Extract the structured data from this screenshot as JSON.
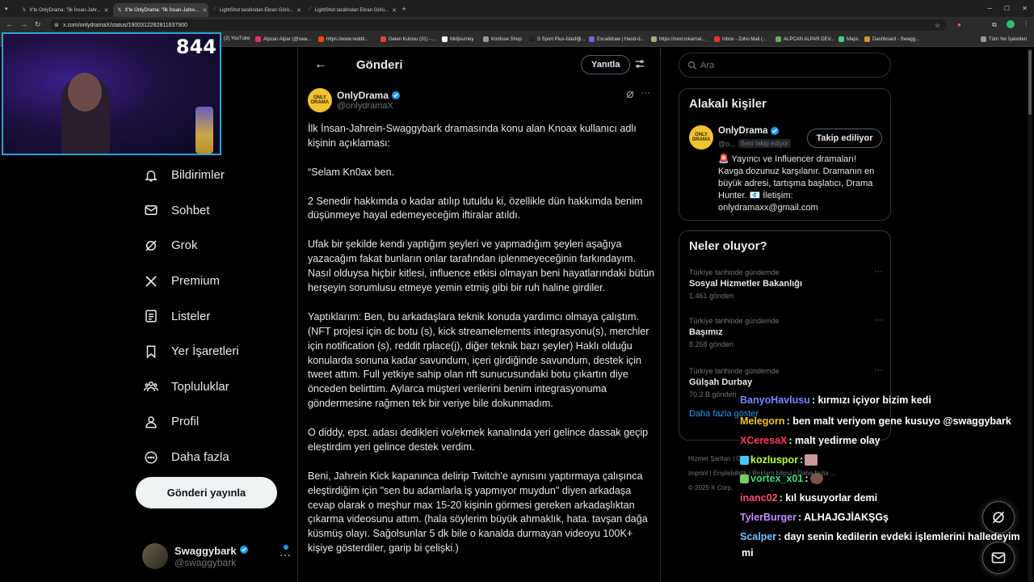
{
  "browser": {
    "tabs": [
      {
        "label": "X'te OnlyDrama: \"İlk İnsan-Jahr...",
        "active": false
      },
      {
        "label": "X'te OnlyDrama: \"İlk İnsan-Jahre...",
        "active": true
      },
      {
        "label": "LightShot tarafından Ekran Görü...",
        "active": false
      },
      {
        "label": "LightShot tarafından Ekran Görü...",
        "active": false
      }
    ],
    "url": "x.com/onlydramaX/status/1900312282811637900",
    "bookmarks": [
      "(2) YouTube",
      "Alpcan Alpar (@swa...",
      "https://www.reddit...",
      "Gelen Kutusu (31) -...",
      "Midjourney",
      "Konfuse Shop",
      "S Sport Plus-İstediği...",
      "Excalidraw | Hand-d...",
      "https://next.inkarnat...",
      "Inbox - Zoho Mail (...",
      "ALPCAN ALPAR DEV...",
      "Maps",
      "Dashboard - Swagg..."
    ],
    "bookmarks_all": "Tüm Yer İşaretleri"
  },
  "stream": {
    "viewer_count": "844"
  },
  "nav": {
    "items": [
      "Bildirimler",
      "Sohbet",
      "Grok",
      "Premium",
      "Listeler",
      "Yer İşaretleri",
      "Topluluklar",
      "Profil",
      "Daha fazla"
    ],
    "post_button": "Gönderi yayınla",
    "account": {
      "name": "Swaggybark",
      "handle": "@swaggybark"
    }
  },
  "header": {
    "title": "Gönderi",
    "reply_label": "Yanıtla"
  },
  "post": {
    "author_name": "OnlyDrama",
    "author_handle": "@onlydramaX",
    "avatar_text": "ONLY DRAMA",
    "text": "İlk İnsan-Jahrein-Swaggybark dramasında konu alan Knoax kullanıcı adlı kişinin açıklaması:\n\n“Selam Kn0ax ben.\n\n2 Senedir hakkımda o kadar atılıp tutuldu ki, özellikle dün hakkımda benim düşünmeye hayal edemeyeceğim iftiralar atıldı.\n\nUfak bir şekilde kendi yaptığım şeyleri ve yapmadığım şeyleri aşağıya yazacağım fakat bunların onlar tarafından iplenmeyeceğinin farkındayım. Nasıl olduysa hiçbir kitlesi, influence etkisi olmayan beni hayatlarındaki bütün herşeyin sorumlusu etmeye yemin etmiş gibi bir ruh haline girdiler.\n\nYaptıklarım: Ben, bu arkadaşlara teknik konuda yardımcı olmaya çalıştım. (NFT projesi için dc botu (s), kick streamelements integrasyonu(s), merchler için notification (s), reddit rplace(j), diğer teknik bazı şeyler) Haklı olduğu konularda sonuna kadar savundum, içeri girdiğinde savundum, destek için tweet attım. Full yetkiye sahip olan nft sunucusundaki botu çıkartın diye önceden belirttim. Aylarca müşteri verilerini benim integrasyonuma göndermesine rağmen tek bir veriye bile dokunmadım.\n\nO diddy, epst. adası dedikleri vo/ekmek kanalında yeri gelince dassak geçip eleştirdim yeri gelince destek verdim.\n\nBeni, Jahrein Kick kapanınca delirip Twitch'e aynısını yaptırmaya çalışınca eleştirdiğim için \"sen bu adamlarla iş yapmıyor muydun\" diyen arkadaşa cevap olarak o meşhur max 15-20 kişinin görmesi gereken arkadaşlıktan çıkarma videosunu attım. (hala söylerim büyük ahmaklık, hata. tavşan dağa küsmüş olayı. Sağolsunlar 5 dk bile o kanalda durmayan videoyu 100K+ kişiye gösterdiler, garip bi çelişki.)"
  },
  "sidebar": {
    "search_placeholder": "Ara",
    "related": {
      "title": "Alakalı kişiler",
      "name": "OnlyDrama",
      "handle": "@o...",
      "follows_you": "Seni takip ediyor",
      "follow_label": "Takip ediliyor",
      "bio": "🚨 Yayıncı ve Influencer dramaları! Kavga dozunuz karşılanır. Dramanın en büyük adresi, tartışma başlatıcı, Drama Hunter. 📧 İletişim: onlydramaxx@gmail.com"
    },
    "trends": {
      "title": "Neler oluyor?",
      "items": [
        {
          "context": "Türkiye tarihinde gündemde",
          "title": "Sosyal Hizmetler Bakanlığı",
          "count": "1.461 gönderi"
        },
        {
          "context": "Türkiye tarihinde gündemde",
          "title": "Başımız",
          "count": "8.268 gönderi"
        },
        {
          "context": "Türkiye tarihinde gündemde",
          "title": "Gülşah Durbay",
          "count": "70,2 B gönderi"
        }
      ],
      "show_more": "Daha fazla göster"
    },
    "footer": {
      "line1": "Hizmet Şartları  |  Gizlilik Politikası  |",
      "line2": "Imprint  |  Erişilebilirlik  |  Reklam bilgisi  |  Daha fazla ...",
      "line3": "© 2025 X Corp."
    }
  },
  "chat": [
    {
      "user": "BanyoHavlusu",
      "color": "#6f8cff",
      "msg": ": kırmızı içiyor bizim kedi"
    },
    {
      "user": "Melegorn",
      "color": "#f0c419",
      "msg": ": ben malt veriyom gene kusuyo @swaggybark"
    },
    {
      "user": "XCeresaX",
      "color": "#ff3d5a",
      "msg": ": malt yedirme olay"
    },
    {
      "user": "kozluspor",
      "color": "#b6ff3a",
      "msg": ":"
    },
    {
      "user": "vortex_x01",
      "color": "#3adf7a",
      "msg": ":"
    },
    {
      "user": "inanc02",
      "color": "#ff4d6d",
      "msg": ": kıl kusuyorlar demi"
    },
    {
      "user": "TylerBurger",
      "color": "#c58cff",
      "msg": ": ALHAJGJİAKŞGş"
    },
    {
      "user": "Scalper",
      "color": "#6fc1ff",
      "msg": ": dayı senin kedilerin evdeki işlemlerini halledeyim"
    },
    {
      "user": "",
      "color": "#fff",
      "msg": "mi"
    }
  ],
  "colors": {
    "accent": "#1d9bf0",
    "logo": "#f2c230",
    "border": "#2f3336",
    "muted": "#71767b"
  }
}
